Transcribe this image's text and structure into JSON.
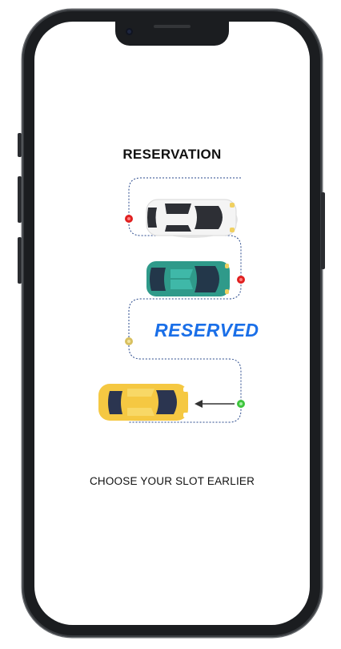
{
  "screen": {
    "title": "RESERVATION",
    "badge": "RESERVED",
    "subtitle": "CHOOSE YOUR SLOT EARLIER"
  },
  "colors": {
    "badge": "#1a6fe8",
    "path": "#2a4a8c",
    "white_car": "#f4f4f4",
    "teal_car": "#2f9a8a",
    "yellow_car": "#f5c842",
    "red_marker": "#e02020",
    "yellow_marker": "#d8c060",
    "green_marker": "#3ec43e"
  },
  "icons": [
    "white-car-icon",
    "teal-car-icon",
    "yellow-car-icon",
    "arrow-left-icon"
  ]
}
